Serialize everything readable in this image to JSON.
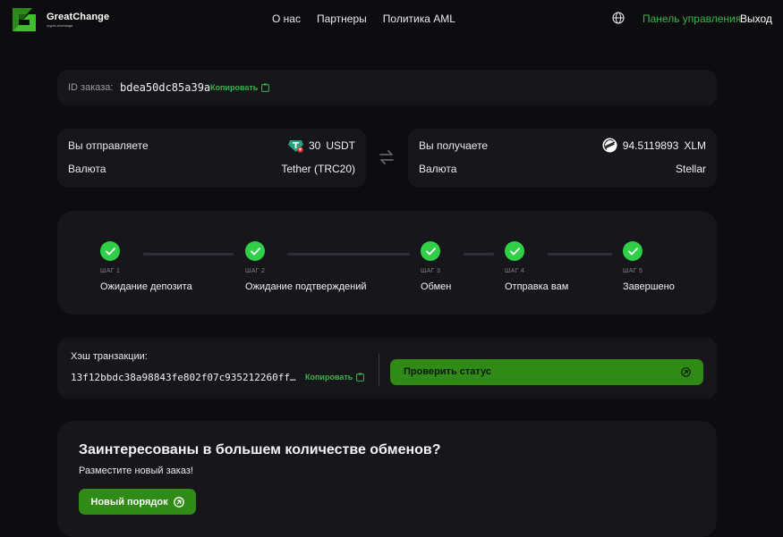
{
  "header": {
    "brand_name": "GreatChange",
    "brand_tagline": "crypto exchange",
    "nav": [
      "О нас",
      "Партнеры",
      "Политика AML"
    ],
    "dashboard_link": "Панель управления",
    "logout_link": "Выход",
    "accent_color": "#3bb34a"
  },
  "order": {
    "id_label": "ID заказа:",
    "id_value": "bdea50dc85a39a",
    "copy_label": "Копировать"
  },
  "send": {
    "label": "Вы отправляете",
    "amount": "30",
    "currency": "USDT",
    "network_label": "Валюта",
    "network_value": "Tether (TRC20)",
    "icon": "tether-trc20-icon"
  },
  "receive": {
    "label": "Вы получаете",
    "amount": "94.5119893",
    "currency": "XLM",
    "network_label": "Валюта",
    "network_value": "Stellar",
    "icon": "stellar-icon"
  },
  "steps": [
    {
      "num": "ШАГ 1",
      "name": "Ожидание депозита",
      "done": true
    },
    {
      "num": "ШАГ 2",
      "name": "Ожидание подтверждений",
      "done": true
    },
    {
      "num": "ШАГ 3",
      "name": "Обмен",
      "done": true
    },
    {
      "num": "ШАГ 4",
      "name": "Отправка вам",
      "done": true
    },
    {
      "num": "ШАГ 5",
      "name": "Завершено",
      "done": true
    }
  ],
  "tx": {
    "label": "Хэш транзакции:",
    "hash": "13f12bbdc38a98843fe802f07c935212260ff…",
    "copy_label": "Копировать",
    "check_button": "Проверить статус"
  },
  "promo": {
    "title": "Заинтересованы в большем количестве обменов?",
    "subtitle": "Разместите новый заказ!",
    "button": "Новый порядок"
  },
  "colors": {
    "success": "#2fcf47",
    "button_green": "#2f8a16",
    "card": "#17171b",
    "background": "#0d0d10"
  }
}
